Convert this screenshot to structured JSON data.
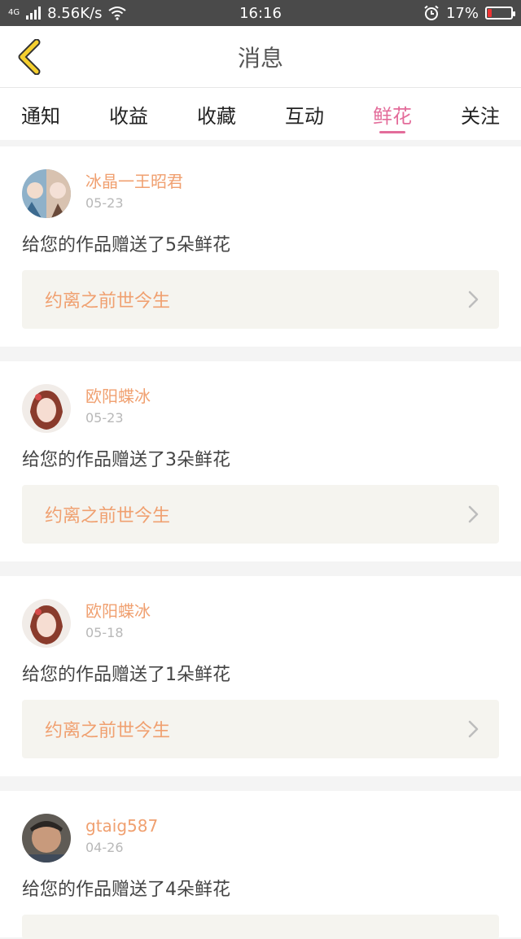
{
  "status_bar": {
    "network_type": "4G",
    "speed": "8.56K/s",
    "time": "16:16",
    "battery_text": "17%",
    "battery_level": 0.17,
    "icons": [
      "signal-icon",
      "wifi-icon",
      "alarm-icon",
      "battery-icon"
    ]
  },
  "header": {
    "title": "消息",
    "back_icon": "chevron-left-icon"
  },
  "tabs": [
    {
      "label": "通知",
      "active": false
    },
    {
      "label": "收益",
      "active": false
    },
    {
      "label": "收藏",
      "active": false
    },
    {
      "label": "互动",
      "active": false
    },
    {
      "label": "鲜花",
      "active": true
    },
    {
      "label": "关注",
      "active": false
    }
  ],
  "messages": [
    {
      "user": "冰晶一王昭君",
      "date": "05-23",
      "text": "给您的作品赠送了5朵鲜花",
      "work": "约离之前世今生",
      "avatar": "avatar-icon"
    },
    {
      "user": "欧阳蝶冰",
      "date": "05-23",
      "text": "给您的作品赠送了3朵鲜花",
      "work": "约离之前世今生",
      "avatar": "avatar-icon"
    },
    {
      "user": "欧阳蝶冰",
      "date": "05-18",
      "text": "给您的作品赠送了1朵鲜花",
      "work": "约离之前世今生",
      "avatar": "avatar-icon"
    },
    {
      "user": "gtaig587",
      "date": "04-26",
      "text": "给您的作品赠送了4朵鲜花",
      "work": "",
      "avatar": "avatar-icon"
    }
  ],
  "colors": {
    "accent_tab": "#e36c9a",
    "username": "#f0a070",
    "back_arrow": "#f0c020"
  }
}
